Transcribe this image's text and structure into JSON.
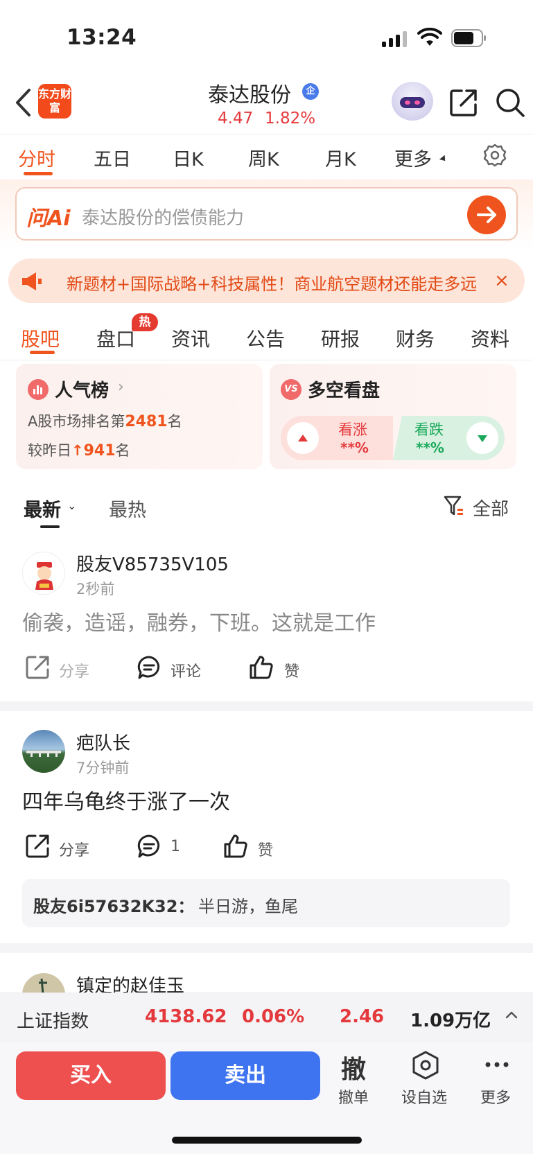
{
  "status": {
    "time": "13:24"
  },
  "header": {
    "logo_text": "东方财富",
    "stock_name": "泰达股份",
    "badge": "企",
    "price": "4.47",
    "change_pct": "1.82%"
  },
  "chart_tabs": [
    "分时",
    "五日",
    "日K",
    "周K",
    "月K",
    "更多"
  ],
  "ai": {
    "logo": "问Ai",
    "placeholder": "泰达股份的偿债能力"
  },
  "banner": {
    "text": "新题材+国际战略+科技属性！商业航空题材还能走多远？",
    "close": "×"
  },
  "content_tabs": [
    "股吧",
    "盘口",
    "资讯",
    "公告",
    "研报",
    "财务",
    "资料"
  ],
  "hot_badge": "热",
  "popularity": {
    "title": "人气榜",
    "rank_prefix": "A股市场排名第",
    "rank": "2481",
    "rank_suffix": "名",
    "change_prefix": "较昨日",
    "change": "941",
    "change_suffix": "名"
  },
  "vs": {
    "icon": "VS",
    "title": "多空看盘",
    "up_label": "看涨",
    "up_value": "**%",
    "down_label": "看跌",
    "down_value": "**%"
  },
  "sort": {
    "latest": "最新",
    "hottest": "最热",
    "filter": "全部"
  },
  "posts": [
    {
      "user": "股友V85735V105",
      "time": "2秒前",
      "text": "偷袭，造谣，融券，下班。这就是工作",
      "share": "分享",
      "comment": "评论",
      "like": "赞"
    },
    {
      "user": "疤队长",
      "time": "7分钟前",
      "text": "四年乌龟终于涨了一次",
      "share": "分享",
      "comment": "1",
      "like": "赞",
      "reply_user": "股友6i57632K32：",
      "reply_text": "半日游，鱼尾"
    },
    {
      "user": "镇定的赵佳玉"
    }
  ],
  "index": {
    "name": "上证指数",
    "value": "4138.62",
    "pct": "0.06%",
    "change": "2.46",
    "amount": "1.09万亿"
  },
  "bottom": {
    "buy": "买入",
    "sell": "卖出",
    "cancel_glyph": "撤",
    "cancel": "撤单",
    "watch": "设自选",
    "more": "更多"
  },
  "colors": {
    "accent": "#f0541e",
    "up": "#e4393c",
    "down": "#1aa95a",
    "sell": "#3f74f0"
  }
}
